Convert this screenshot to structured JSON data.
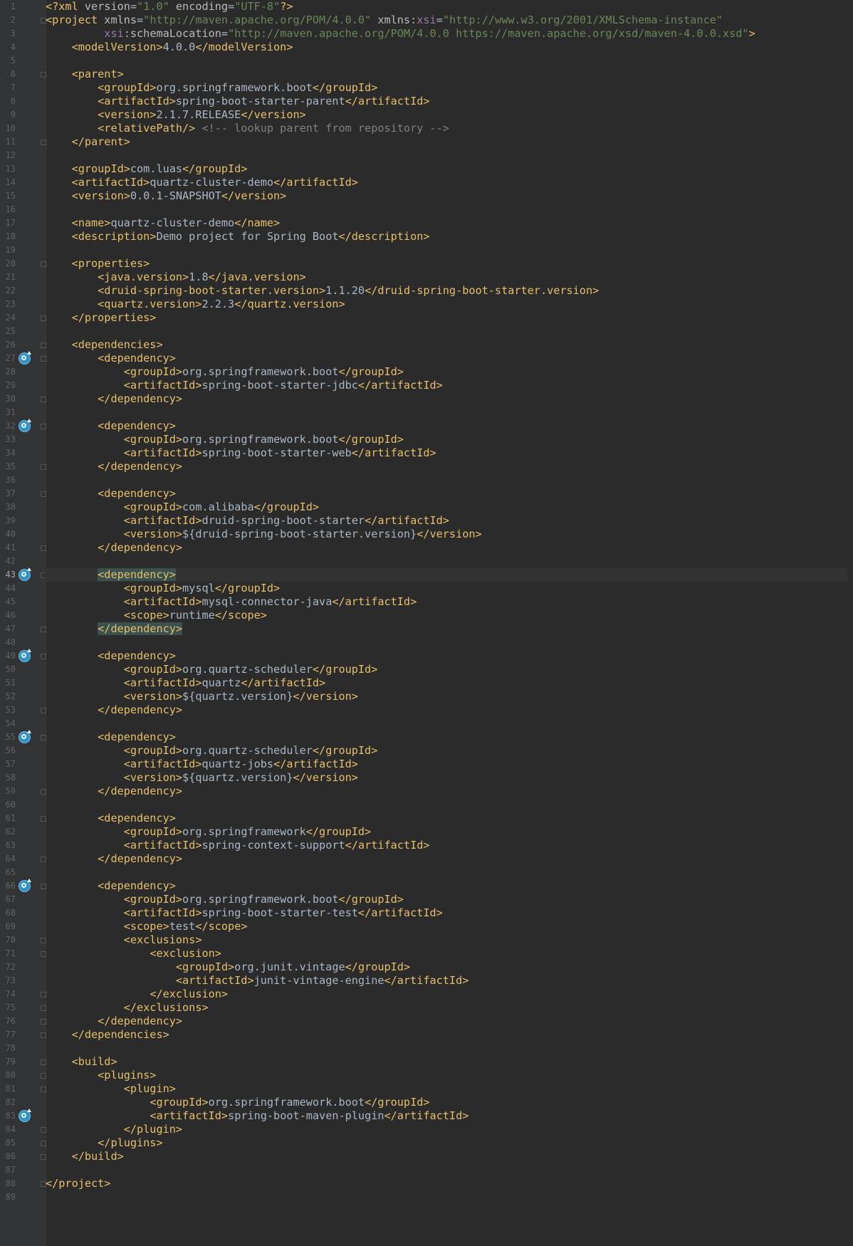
{
  "editor": {
    "language": "xml",
    "current_line": 43,
    "highlighted_lines": [
      43,
      47
    ],
    "run_gutter_lines": [
      27,
      32,
      43,
      49,
      55,
      66,
      83
    ],
    "fold_lines": [
      2,
      6,
      11,
      20,
      24,
      26,
      27,
      30,
      32,
      35,
      37,
      41,
      43,
      47,
      49,
      53,
      55,
      59,
      61,
      64,
      66,
      70,
      71,
      74,
      75,
      76,
      77,
      79,
      80,
      81,
      84,
      85,
      86,
      88
    ],
    "lines": [
      [
        [
          "t",
          "<?xml "
        ],
        [
          "a",
          "version"
        ],
        [
          "tx",
          "="
        ],
        [
          "v",
          "\"1.0\""
        ],
        [
          "a",
          " encoding"
        ],
        [
          "tx",
          "="
        ],
        [
          "v",
          "\"UTF-8\""
        ],
        [
          "t",
          "?>"
        ]
      ],
      [
        [
          "t",
          "<project "
        ],
        [
          "a",
          "xmlns"
        ],
        [
          "tx",
          "="
        ],
        [
          "v",
          "\"http://maven.apache.org/POM/4.0.0\""
        ],
        [
          "a",
          " xmlns"
        ],
        [
          "tx",
          ":"
        ],
        [
          "ns",
          "xsi"
        ],
        [
          "tx",
          "="
        ],
        [
          "v",
          "\"http://www.w3.org/2001/XMLSchema-instance\""
        ]
      ],
      [
        [
          "tx",
          "         "
        ],
        [
          "ns",
          "xsi"
        ],
        [
          "tx",
          ":"
        ],
        [
          "a",
          "schemaLocation"
        ],
        [
          "tx",
          "="
        ],
        [
          "v",
          "\"http://maven.apache.org/POM/4.0.0 https://maven.apache.org/xsd/maven-4.0.0.xsd\""
        ],
        [
          "t",
          ">"
        ]
      ],
      [
        [
          "tx",
          "    "
        ],
        [
          "t",
          "<modelVersion>"
        ],
        [
          "tx",
          "4.0.0"
        ],
        [
          "t",
          "</modelVersion>"
        ]
      ],
      [],
      [
        [
          "tx",
          "    "
        ],
        [
          "t",
          "<parent>"
        ]
      ],
      [
        [
          "tx",
          "        "
        ],
        [
          "t",
          "<groupId>"
        ],
        [
          "tx",
          "org.springframework.boot"
        ],
        [
          "t",
          "</groupId>"
        ]
      ],
      [
        [
          "tx",
          "        "
        ],
        [
          "t",
          "<artifactId>"
        ],
        [
          "tx",
          "spring-boot-starter-parent"
        ],
        [
          "t",
          "</artifactId>"
        ]
      ],
      [
        [
          "tx",
          "        "
        ],
        [
          "t",
          "<version>"
        ],
        [
          "tx",
          "2.1.7.RELEASE"
        ],
        [
          "t",
          "</version>"
        ]
      ],
      [
        [
          "tx",
          "        "
        ],
        [
          "t",
          "<relativePath/>"
        ],
        [
          "c",
          " <!-- lookup parent from repository -->"
        ]
      ],
      [
        [
          "tx",
          "    "
        ],
        [
          "t",
          "</parent>"
        ]
      ],
      [],
      [
        [
          "tx",
          "    "
        ],
        [
          "t",
          "<groupId>"
        ],
        [
          "tx",
          "com.luas"
        ],
        [
          "t",
          "</groupId>"
        ]
      ],
      [
        [
          "tx",
          "    "
        ],
        [
          "t",
          "<artifactId>"
        ],
        [
          "tx",
          "quartz-cluster-demo"
        ],
        [
          "t",
          "</artifactId>"
        ]
      ],
      [
        [
          "tx",
          "    "
        ],
        [
          "t",
          "<version>"
        ],
        [
          "tx",
          "0.0.1-SNAPSHOT"
        ],
        [
          "t",
          "</version>"
        ]
      ],
      [],
      [
        [
          "tx",
          "    "
        ],
        [
          "t",
          "<name>"
        ],
        [
          "tx",
          "quartz-cluster-demo"
        ],
        [
          "t",
          "</name>"
        ]
      ],
      [
        [
          "tx",
          "    "
        ],
        [
          "t",
          "<description>"
        ],
        [
          "tx",
          "Demo project for Spring Boot"
        ],
        [
          "t",
          "</description>"
        ]
      ],
      [],
      [
        [
          "tx",
          "    "
        ],
        [
          "t",
          "<properties>"
        ]
      ],
      [
        [
          "tx",
          "        "
        ],
        [
          "t",
          "<java.version>"
        ],
        [
          "tx",
          "1.8"
        ],
        [
          "t",
          "</java.version>"
        ]
      ],
      [
        [
          "tx",
          "        "
        ],
        [
          "t",
          "<druid-spring-boot-starter.version>"
        ],
        [
          "tx",
          "1.1.20"
        ],
        [
          "t",
          "</druid-spring-boot-starter.version>"
        ]
      ],
      [
        [
          "tx",
          "        "
        ],
        [
          "t",
          "<quartz.version>"
        ],
        [
          "tx",
          "2.2.3"
        ],
        [
          "t",
          "</quartz.version>"
        ]
      ],
      [
        [
          "tx",
          "    "
        ],
        [
          "t",
          "</properties>"
        ]
      ],
      [],
      [
        [
          "tx",
          "    "
        ],
        [
          "t",
          "<dependencies>"
        ]
      ],
      [
        [
          "tx",
          "        "
        ],
        [
          "t",
          "<dependency>"
        ]
      ],
      [
        [
          "tx",
          "            "
        ],
        [
          "t",
          "<groupId>"
        ],
        [
          "tx",
          "org.springframework.boot"
        ],
        [
          "t",
          "</groupId>"
        ]
      ],
      [
        [
          "tx",
          "            "
        ],
        [
          "t",
          "<artifactId>"
        ],
        [
          "tx",
          "spring-boot-starter-jdbc"
        ],
        [
          "t",
          "</artifactId>"
        ]
      ],
      [
        [
          "tx",
          "        "
        ],
        [
          "t",
          "</dependency>"
        ]
      ],
      [],
      [
        [
          "tx",
          "        "
        ],
        [
          "t",
          "<dependency>"
        ]
      ],
      [
        [
          "tx",
          "            "
        ],
        [
          "t",
          "<groupId>"
        ],
        [
          "tx",
          "org.springframework.boot"
        ],
        [
          "t",
          "</groupId>"
        ]
      ],
      [
        [
          "tx",
          "            "
        ],
        [
          "t",
          "<artifactId>"
        ],
        [
          "tx",
          "spring-boot-starter-web"
        ],
        [
          "t",
          "</artifactId>"
        ]
      ],
      [
        [
          "tx",
          "        "
        ],
        [
          "t",
          "</dependency>"
        ]
      ],
      [],
      [
        [
          "tx",
          "        "
        ],
        [
          "t",
          "<dependency>"
        ]
      ],
      [
        [
          "tx",
          "            "
        ],
        [
          "t",
          "<groupId>"
        ],
        [
          "tx",
          "com.alibaba"
        ],
        [
          "t",
          "</groupId>"
        ]
      ],
      [
        [
          "tx",
          "            "
        ],
        [
          "t",
          "<artifactId>"
        ],
        [
          "tx",
          "druid-spring-boot-starter"
        ],
        [
          "t",
          "</artifactId>"
        ]
      ],
      [
        [
          "tx",
          "            "
        ],
        [
          "t",
          "<version>"
        ],
        [
          "tx",
          "${druid-spring-boot-starter.version}"
        ],
        [
          "t",
          "</version>"
        ]
      ],
      [
        [
          "tx",
          "        "
        ],
        [
          "t",
          "</dependency>"
        ]
      ],
      [],
      [
        [
          "tx",
          "        "
        ],
        [
          "t hl",
          "<dependency>"
        ]
      ],
      [
        [
          "tx",
          "            "
        ],
        [
          "t",
          "<groupId>"
        ],
        [
          "tx",
          "mysql"
        ],
        [
          "t",
          "</groupId>"
        ]
      ],
      [
        [
          "tx",
          "            "
        ],
        [
          "t",
          "<artifactId>"
        ],
        [
          "tx",
          "mysql-connector-java"
        ],
        [
          "t",
          "</artifactId>"
        ]
      ],
      [
        [
          "tx",
          "            "
        ],
        [
          "t",
          "<scope>"
        ],
        [
          "tx",
          "runtime"
        ],
        [
          "t",
          "</scope>"
        ]
      ],
      [
        [
          "tx",
          "        "
        ],
        [
          "t hl",
          "</dependency>"
        ]
      ],
      [],
      [
        [
          "tx",
          "        "
        ],
        [
          "t",
          "<dependency>"
        ]
      ],
      [
        [
          "tx",
          "            "
        ],
        [
          "t",
          "<groupId>"
        ],
        [
          "tx",
          "org.quartz-scheduler"
        ],
        [
          "t",
          "</groupId>"
        ]
      ],
      [
        [
          "tx",
          "            "
        ],
        [
          "t",
          "<artifactId>"
        ],
        [
          "tx",
          "quartz"
        ],
        [
          "t",
          "</artifactId>"
        ]
      ],
      [
        [
          "tx",
          "            "
        ],
        [
          "t",
          "<version>"
        ],
        [
          "tx",
          "${quartz.version}"
        ],
        [
          "t",
          "</version>"
        ]
      ],
      [
        [
          "tx",
          "        "
        ],
        [
          "t",
          "</dependency>"
        ]
      ],
      [],
      [
        [
          "tx",
          "        "
        ],
        [
          "t",
          "<dependency>"
        ]
      ],
      [
        [
          "tx",
          "            "
        ],
        [
          "t",
          "<groupId>"
        ],
        [
          "tx",
          "org.quartz-scheduler"
        ],
        [
          "t",
          "</groupId>"
        ]
      ],
      [
        [
          "tx",
          "            "
        ],
        [
          "t",
          "<artifactId>"
        ],
        [
          "tx",
          "quartz-jobs"
        ],
        [
          "t",
          "</artifactId>"
        ]
      ],
      [
        [
          "tx",
          "            "
        ],
        [
          "t",
          "<version>"
        ],
        [
          "tx",
          "${quartz.version}"
        ],
        [
          "t",
          "</version>"
        ]
      ],
      [
        [
          "tx",
          "        "
        ],
        [
          "t",
          "</dependency>"
        ]
      ],
      [],
      [
        [
          "tx",
          "        "
        ],
        [
          "t",
          "<dependency>"
        ]
      ],
      [
        [
          "tx",
          "            "
        ],
        [
          "t",
          "<groupId>"
        ],
        [
          "tx",
          "org.springframework"
        ],
        [
          "t",
          "</groupId>"
        ]
      ],
      [
        [
          "tx",
          "            "
        ],
        [
          "t",
          "<artifactId>"
        ],
        [
          "tx",
          "spring-context-support"
        ],
        [
          "t",
          "</artifactId>"
        ]
      ],
      [
        [
          "tx",
          "        "
        ],
        [
          "t",
          "</dependency>"
        ]
      ],
      [],
      [
        [
          "tx",
          "        "
        ],
        [
          "t",
          "<dependency>"
        ]
      ],
      [
        [
          "tx",
          "            "
        ],
        [
          "t",
          "<groupId>"
        ],
        [
          "tx",
          "org.springframework.boot"
        ],
        [
          "t",
          "</groupId>"
        ]
      ],
      [
        [
          "tx",
          "            "
        ],
        [
          "t",
          "<artifactId>"
        ],
        [
          "tx",
          "spring-boot-starter-test"
        ],
        [
          "t",
          "</artifactId>"
        ]
      ],
      [
        [
          "tx",
          "            "
        ],
        [
          "t",
          "<scope>"
        ],
        [
          "tx",
          "test"
        ],
        [
          "t",
          "</scope>"
        ]
      ],
      [
        [
          "tx",
          "            "
        ],
        [
          "t",
          "<exclusions>"
        ]
      ],
      [
        [
          "tx",
          "                "
        ],
        [
          "t",
          "<exclusion>"
        ]
      ],
      [
        [
          "tx",
          "                    "
        ],
        [
          "t",
          "<groupId>"
        ],
        [
          "tx",
          "org.junit.vintage"
        ],
        [
          "t",
          "</groupId>"
        ]
      ],
      [
        [
          "tx",
          "                    "
        ],
        [
          "t",
          "<artifactId>"
        ],
        [
          "tx",
          "junit-vintage-engine"
        ],
        [
          "t",
          "</artifactId>"
        ]
      ],
      [
        [
          "tx",
          "                "
        ],
        [
          "t",
          "</exclusion>"
        ]
      ],
      [
        [
          "tx",
          "            "
        ],
        [
          "t",
          "</exclusions>"
        ]
      ],
      [
        [
          "tx",
          "        "
        ],
        [
          "t",
          "</dependency>"
        ]
      ],
      [
        [
          "tx",
          "    "
        ],
        [
          "t",
          "</dependencies>"
        ]
      ],
      [],
      [
        [
          "tx",
          "    "
        ],
        [
          "t",
          "<build>"
        ]
      ],
      [
        [
          "tx",
          "        "
        ],
        [
          "t",
          "<plugins>"
        ]
      ],
      [
        [
          "tx",
          "            "
        ],
        [
          "t",
          "<plugin>"
        ]
      ],
      [
        [
          "tx",
          "                "
        ],
        [
          "t",
          "<groupId>"
        ],
        [
          "tx",
          "org.springframework.boot"
        ],
        [
          "t",
          "</groupId>"
        ]
      ],
      [
        [
          "tx",
          "                "
        ],
        [
          "t",
          "<artifactId>"
        ],
        [
          "tx",
          "spring-boot-maven-plugin"
        ],
        [
          "t",
          "</artifactId>"
        ]
      ],
      [
        [
          "tx",
          "            "
        ],
        [
          "t",
          "</plugin>"
        ]
      ],
      [
        [
          "tx",
          "        "
        ],
        [
          "t",
          "</plugins>"
        ]
      ],
      [
        [
          "tx",
          "    "
        ],
        [
          "t",
          "</build>"
        ]
      ],
      [],
      [
        [
          "t",
          "</project>"
        ]
      ],
      []
    ]
  }
}
